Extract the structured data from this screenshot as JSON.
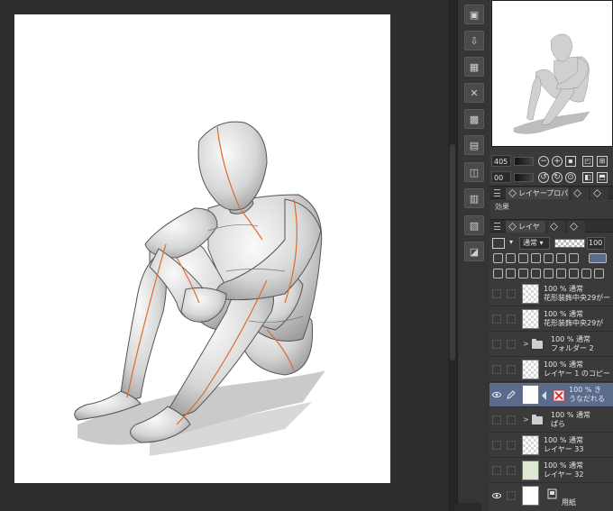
{
  "navigator": {
    "zoom_value": "405",
    "angle_value": "00"
  },
  "tabs": {
    "layer_property": "レイヤープロパ",
    "layer": "レイヤー"
  },
  "effect_label": "効果",
  "blend": {
    "mode": "通常",
    "opacity": "100"
  },
  "layers": [
    {
      "mode": "100 % 通常",
      "name": "花形装飾中央29がー",
      "type": "layer",
      "visible": false,
      "thumb": "checker"
    },
    {
      "mode": "100 % 通常",
      "name": "花形装飾中央29が",
      "type": "layer",
      "visible": false,
      "thumb": "checker"
    },
    {
      "mode": "100 % 通常",
      "name": "フォルダー 2",
      "type": "folder",
      "visible": false
    },
    {
      "mode": "100 % 通常",
      "name": "レイヤー 1 のコピー",
      "type": "layer",
      "visible": false,
      "thumb": "checker"
    },
    {
      "mode": "100 % き",
      "name": "うなだれる",
      "type": "3d",
      "visible": true,
      "selected": true
    },
    {
      "mode": "100 % 通常",
      "name": "ぱら",
      "type": "folder",
      "visible": false
    },
    {
      "mode": "100 % 通常",
      "name": "レイヤー 33",
      "type": "layer",
      "visible": false,
      "thumb": "checker"
    },
    {
      "mode": "100 % 通常",
      "name": "レイヤー 32",
      "type": "layer",
      "visible": false,
      "thumb": "green"
    },
    {
      "mode": "",
      "name": "用紙",
      "type": "paper",
      "visible": true,
      "thumb": "white"
    }
  ],
  "icons": {
    "tool_column": [
      "camera-icon",
      "import-icon",
      "delete-grid-icon",
      "clear-icon",
      "screentone-icon",
      "frame-icon",
      "convert-icon",
      "copy-icon",
      "paste-icon",
      "export-icon"
    ],
    "selection_accent": "#5b6b8c",
    "mannequin_accent": "#e06a2c"
  }
}
